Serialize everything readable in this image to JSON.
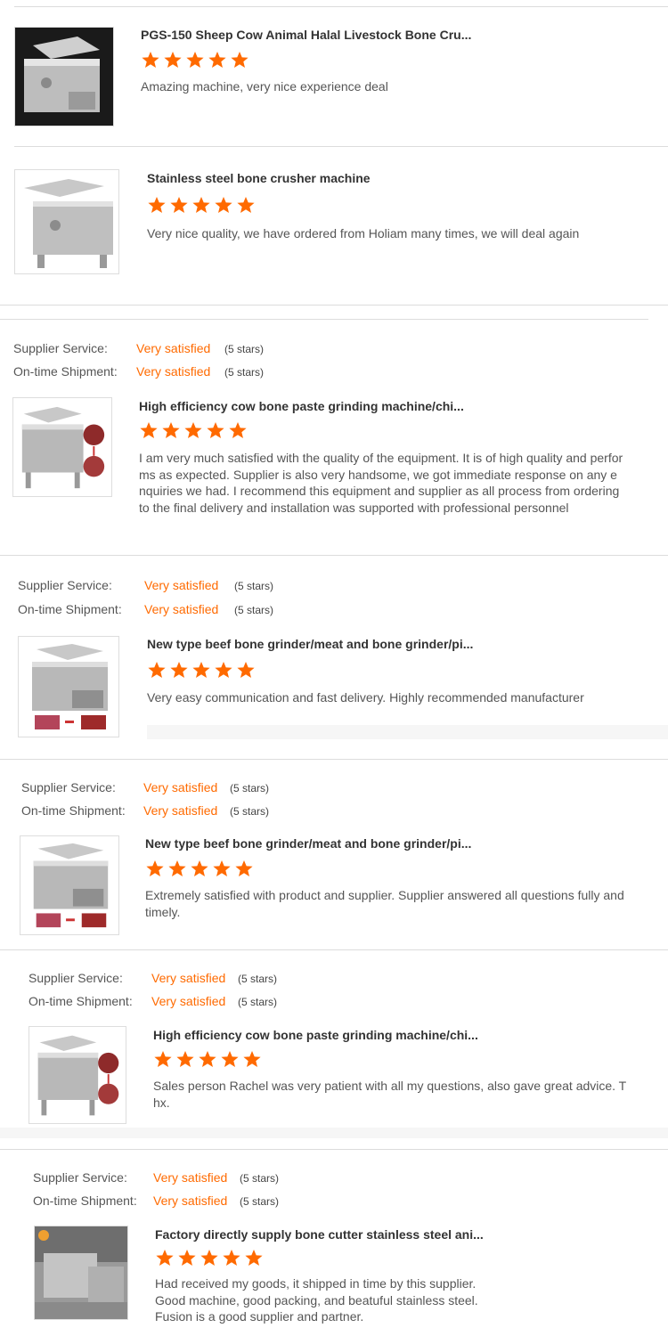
{
  "colors": {
    "accent": "#ff6a00",
    "label": "#555555",
    "divider": "#dcdcdc"
  },
  "labels": {
    "supplier_service": "Supplier Service:",
    "ontime_shipment": "On-time Shipment:",
    "very_satisfied": "Very satisfied",
    "five_stars": "(5 stars)"
  },
  "reviews": [
    {
      "product": "PGS-150 Sheep Cow Animal Halal Livestock Bone Cru...",
      "stars": 5,
      "text": "Amazing machine, very nice experience deal",
      "image_icon": "bone-crusher-machine-icon"
    },
    {
      "product": "Stainless steel bone crusher machine",
      "stars": 5,
      "text": "Very nice quality, we have ordered from Holiam many times, we will deal again",
      "image_icon": "bone-crusher-machine-icon"
    },
    {
      "product": "High efficiency cow bone paste grinding machine/chi...",
      "stars": 5,
      "text": "I am very much satisfied with the quality of the equipment. It is of high quality and performs as expected. Supplier is also very handsome, we got immediate response on any enquiries we had. I recommend this equipment and supplier as all process from ordering to the final delivery and installation was supported with professional personnel",
      "image_icon": "bone-grinder-with-meat-icon"
    },
    {
      "product": "New type beef bone grinder/meat and bone grinder/pi...",
      "stars": 5,
      "text": "Very easy communication and fast delivery.  Highly recommended manufacturer",
      "image_icon": "bone-grinder-with-meat-icon"
    },
    {
      "product": "New type beef bone grinder/meat and bone grinder/pi...",
      "stars": 5,
      "text": "Extremely satisfied with product and supplier.  Supplier answered all questions fully and timely.",
      "image_icon": "bone-grinder-with-meat-icon"
    },
    {
      "product": "High efficiency cow bone paste grinding machine/chi...",
      "stars": 5,
      "text": "Sales person Rachel was very patient with all my questions, also gave great advice. Thx.",
      "image_icon": "bone-grinder-with-meat-icon"
    },
    {
      "product": "Factory directly supply bone cutter stainless steel ani...",
      "stars": 5,
      "text": "Had received my goods, it shipped in time by this supplier.\nGood machine,  good packing, and beatuful stainless steel.\nFusion is a good supplier and partner.",
      "image_icon": "factory-machine-photo-icon"
    }
  ]
}
